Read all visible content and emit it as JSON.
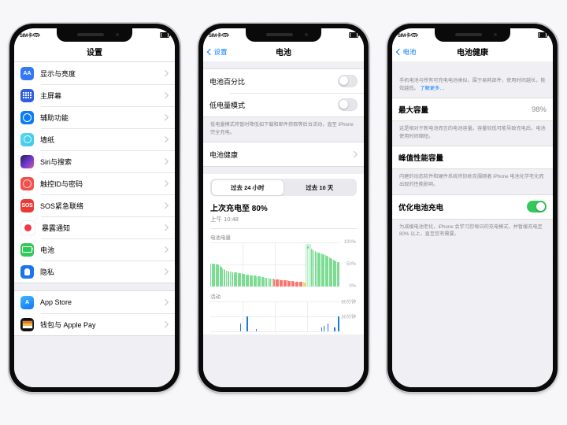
{
  "statusbar": {
    "carrier": "SIM卡",
    "wifi_icon": "wifi-icon",
    "battery_icon": "battery-icon"
  },
  "phone1": {
    "nav": {
      "title": "设置"
    },
    "group1": [
      {
        "label": "显示与亮度",
        "icon": "display-brightness-icon"
      },
      {
        "label": "主屏幕",
        "icon": "home-screen-icon"
      },
      {
        "label": "辅助功能",
        "icon": "accessibility-icon"
      },
      {
        "label": "墙纸",
        "icon": "wallpaper-icon"
      },
      {
        "label": "Siri与搜索",
        "icon": "siri-search-icon"
      },
      {
        "label": "触控ID与密码",
        "icon": "touch-id-passcode-icon"
      },
      {
        "label": "SOS紧急联络",
        "icon": "emergency-sos-icon"
      },
      {
        "label": "暴露通知",
        "icon": "exposure-notifications-icon"
      },
      {
        "label": "电池",
        "icon": "battery-icon"
      },
      {
        "label": "隐私",
        "icon": "privacy-icon"
      }
    ],
    "group2": [
      {
        "label": "App Store",
        "icon": "app-store-icon"
      },
      {
        "label": "钱包与 Apple Pay",
        "icon": "wallet-apple-pay-icon"
      }
    ]
  },
  "phone2": {
    "nav": {
      "back": "设置",
      "title": "电池"
    },
    "battery_percentage": {
      "label": "电池百分比",
      "on": false
    },
    "low_power_mode": {
      "label": "低电量模式",
      "on": false
    },
    "low_power_note": "低电量模式将暂时降低如下载和邮件获取等后台活动，直至 iPhone 完全充电。",
    "battery_health": {
      "label": "电池健康"
    },
    "segments": [
      {
        "label": "过去 24 小时",
        "active": true
      },
      {
        "label": "过去 10 天",
        "active": false
      }
    ],
    "last_charge": {
      "title": "上次充电至 80%",
      "time": "上午 10:48"
    },
    "chart_data": [
      {
        "type": "bar",
        "title": "电池电量",
        "ylabel": "",
        "xlabel": "",
        "ylim": [
          0,
          100
        ],
        "yticks": [
          "0%",
          "50%",
          "100%"
        ],
        "grid": true,
        "colors": {
          "green": "#7ddc94",
          "red": "#f7766f",
          "yellow": "#f5d94c",
          "charging_fill": "#d9f5e1"
        },
        "annotation": "charging-bolt",
        "values": [
          52,
          52,
          52,
          51,
          51,
          50,
          50,
          47,
          44,
          41,
          39,
          37,
          36,
          35,
          34,
          33,
          33,
          32,
          32,
          31,
          31,
          30,
          30,
          29,
          29,
          28,
          28,
          27,
          27,
          26,
          26,
          25,
          25,
          24,
          24,
          23,
          23,
          22,
          22,
          21,
          21,
          20,
          20,
          19,
          19,
          18,
          18,
          17,
          17,
          16,
          16,
          15,
          15,
          15,
          14,
          14,
          14,
          13,
          13,
          13,
          12,
          12,
          12,
          12,
          11,
          11,
          11,
          11,
          10,
          10,
          10,
          10,
          9,
          9,
          28,
          60,
          88,
          86,
          84,
          82,
          80,
          78,
          77,
          76,
          75,
          74,
          73,
          72,
          71,
          70,
          68,
          66,
          64,
          62,
          60,
          58,
          56,
          55,
          54
        ],
        "segment_colors": [
          "g",
          "g",
          "g",
          "g",
          "g",
          "g",
          "g",
          "g",
          "g",
          "g",
          "g",
          "g",
          "g",
          "g",
          "g",
          "g",
          "g",
          "g",
          "g",
          "g",
          "g",
          "g",
          "g",
          "g",
          "g",
          "g",
          "g",
          "g",
          "g",
          "g",
          "g",
          "g",
          "g",
          "g",
          "g",
          "g",
          "g",
          "g",
          "g",
          "g",
          "g",
          "g",
          "g",
          "g",
          "g",
          "g",
          "g",
          "g",
          "r",
          "r",
          "r",
          "r",
          "r",
          "r",
          "r",
          "r",
          "r",
          "r",
          "r",
          "r",
          "r",
          "r",
          "r",
          "r",
          "r",
          "r",
          "r",
          "r",
          "r",
          "r",
          "r",
          "y",
          "y",
          "y",
          "y",
          "g",
          "g",
          "g",
          "g",
          "g",
          "g",
          "g",
          "g",
          "g",
          "g",
          "g",
          "g",
          "g",
          "g",
          "g",
          "g",
          "g",
          "g",
          "g",
          "g",
          "g",
          "g",
          "g",
          "g"
        ]
      },
      {
        "type": "bar",
        "title": "活动",
        "ylabel": "",
        "xlabel": "60分钟",
        "ylim": [
          0,
          60
        ],
        "yticks": [
          "30分钟",
          "60分钟"
        ],
        "grid": true,
        "color": "#1f7ae0",
        "values": [
          0,
          0,
          0,
          0,
          0,
          0,
          0,
          0,
          0,
          0,
          0,
          0,
          0,
          0,
          0,
          0,
          0,
          0,
          0,
          0,
          0,
          0,
          0,
          16,
          0,
          0,
          0,
          0,
          30,
          0,
          0,
          0,
          0,
          0,
          0,
          4,
          0,
          0,
          0,
          0,
          0,
          0,
          0,
          0,
          0,
          0,
          0,
          0,
          0,
          0,
          0,
          0,
          0,
          0,
          0,
          0,
          0,
          0,
          0,
          0,
          0,
          0,
          0,
          0,
          0,
          0,
          0,
          0,
          0,
          0,
          0,
          0,
          0,
          0,
          0,
          0,
          0,
          0,
          0,
          0,
          0,
          0,
          0,
          0,
          0,
          8,
          0,
          11,
          0,
          0,
          16,
          0,
          0,
          0,
          0,
          7,
          0,
          0,
          29
        ]
      }
    ]
  },
  "phone3": {
    "nav": {
      "back": "电池",
      "title": "电池健康"
    },
    "intro": "手机电池与所有可充电电池类似，属于易耗部件，使用时间越长，能效越低。",
    "intro_link": "了解更多…",
    "max_capacity": {
      "label": "最大容量",
      "value": "98%"
    },
    "max_capacity_note": "这是相对于新电池而言的电池容量。容量较低可能导致充电后，电池使用时间缩短。",
    "peak_performance": {
      "label": "峰值性能容量"
    },
    "peak_performance_note": "内建的动态软件和硬件系统将协助克服随着 iPhone 电池化学老化而出现的性能影响。",
    "optimized_charging": {
      "label": "优化电池充电",
      "on": true
    },
    "optimized_charging_note": "为减缓电池老化，iPhone 会学习您每日的充电模式，并暂缓充电至 80% 以上，直至您有需要。"
  },
  "colors": {
    "accent": "#0a7cff",
    "green": "#34c759",
    "bg": "#efeff4"
  }
}
